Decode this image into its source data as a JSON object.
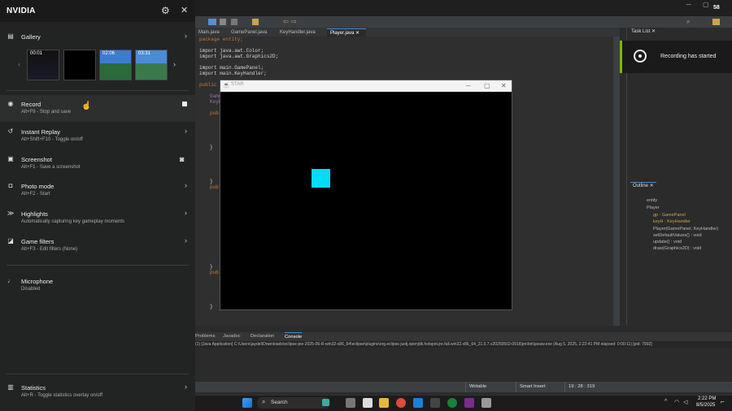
{
  "nvidia": {
    "title": "NVIDIA",
    "gallery": {
      "label": "Gallery",
      "thumbs": [
        "00:01",
        "",
        "02:06",
        "03:31"
      ]
    },
    "record": {
      "label": "Record",
      "shortcut": "Alt+F9 - Stop and save"
    },
    "instant_replay": {
      "label": "Instant Replay",
      "shortcut": "Alt+Shift+F10 - Toggle on/off"
    },
    "screenshot": {
      "label": "Screenshot",
      "shortcut": "Alt+F1 - Save a screenshot"
    },
    "photo_mode": {
      "label": "Photo mode",
      "shortcut": "Alt+F2 - Start"
    },
    "highlights": {
      "label": "Highlights",
      "desc": "Automatically capturing key gameplay moments"
    },
    "game_filters": {
      "label": "Game filters",
      "shortcut": "Alt+F3 - Edit filters (None)"
    },
    "microphone": {
      "label": "Microphone",
      "status": "Disabled"
    },
    "statistics": {
      "label": "Statistics",
      "shortcut": "Alt+R - Toggle statistics overlay on/off"
    }
  },
  "notification": {
    "text": "Recording has started"
  },
  "eclipse": {
    "corner_label": "58",
    "tabs": [
      "Main.java",
      "GamePanel.java",
      "KeyHandler.java",
      "Player.java"
    ],
    "task_list": "Task List",
    "outline_title": "Outline",
    "outline_items": [
      {
        "text": "entity",
        "color": "#bbb"
      },
      {
        "text": "Player",
        "color": "#bbb"
      },
      {
        "text": "gp : GamePanel",
        "color": "#c9a44e"
      },
      {
        "text": "keyH : KeyHandler",
        "color": "#c9a44e"
      },
      {
        "text": "Player(GamePanel, KeyHandler)",
        "color": "#bbb"
      },
      {
        "text": "setDefaultValues() : void",
        "color": "#bbb"
      },
      {
        "text": "update() : void",
        "color": "#bbb"
      },
      {
        "text": "draw(Graphics2D) : void",
        "color": "#bbb"
      }
    ],
    "code": {
      "l1": "package entity;",
      "l2": "import java.awt.Color;",
      "l3": "import java.awt.Graphics2D;",
      "l4": "import main.GamePanel;",
      "l5": "import main.KeyHandler;",
      "l6": "public",
      "l7": "Game",
      "l8": "KeyH",
      "l9": "publ",
      "l10": "}",
      "l11": "}",
      "l12": "publ",
      "l13": "}",
      "l14": "publ",
      "l15": "}"
    },
    "console_tabs": [
      "Problems",
      "Javadoc",
      "Declaration",
      "Console"
    ],
    "console_line": "(1) [Java Application] C:\\Users\\jaydel\\Downloads\\eclipse-jee-2025-06-R-win32-x86_64\\eclipse\\plugins\\org.eclipse.justj.openjdk.hotspot.jre.full.win32.x86_64_21.0.7.v20250502-0916\\jre\\bin\\javaw.exe (Aug 5, 2025, 2:22:41 PM elapsed: 0:00:11) [pid: 7992]",
    "status": {
      "writable": "Writable",
      "insert": "Smart Insert",
      "pos": "19 : 28 : 319"
    }
  },
  "star_window": {
    "title": "STAR",
    "player_color": "#00ddf4"
  },
  "taskbar": {
    "search": "Search",
    "time": "2:22 PM",
    "date": "8/5/2025"
  }
}
